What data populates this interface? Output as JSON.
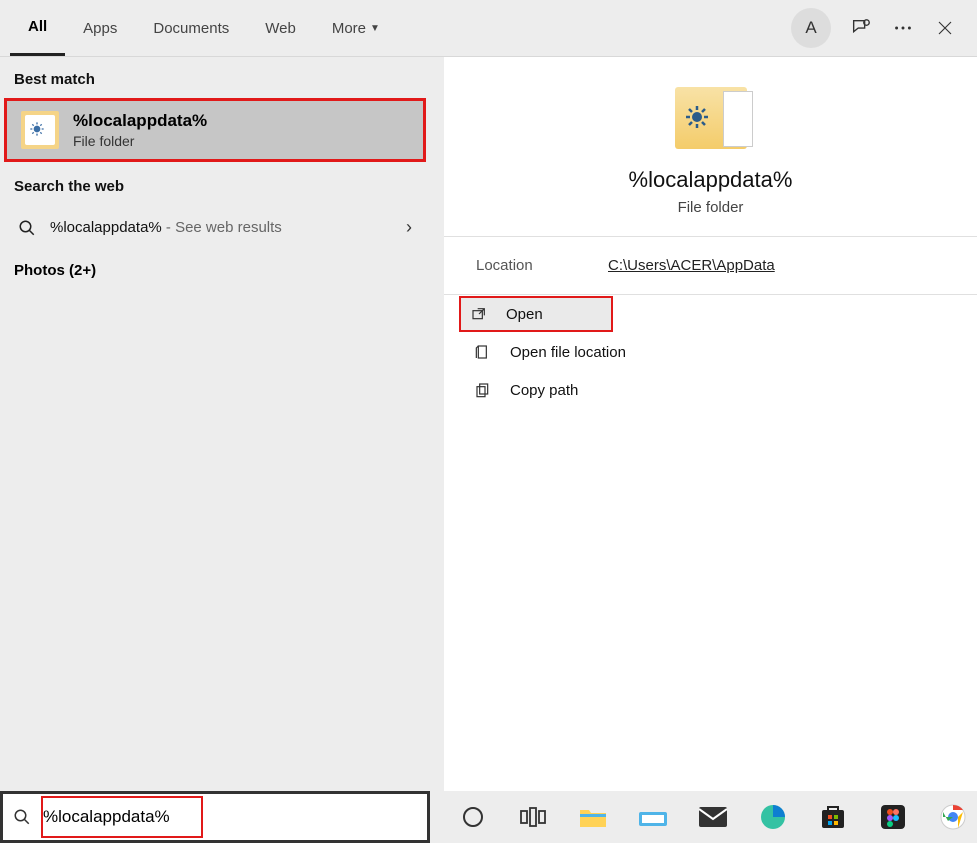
{
  "tabs": {
    "all": "All",
    "apps": "Apps",
    "documents": "Documents",
    "web": "Web",
    "more": "More"
  },
  "avatar_letter": "A",
  "sections": {
    "best_match": "Best match",
    "search_web": "Search the web",
    "photos": "Photos (2+)"
  },
  "best_match": {
    "title": "%localappdata%",
    "subtitle": "File folder"
  },
  "web_result": {
    "query": "%localappdata%",
    "hint": " - See web results"
  },
  "preview": {
    "title": "%localappdata%",
    "subtitle": "File folder",
    "location_label": "Location",
    "location_value": "C:\\Users\\ACER\\AppData"
  },
  "actions": {
    "open": "Open",
    "open_location": "Open file location",
    "copy_path": "Copy path"
  },
  "search_value": "%localappdata%"
}
